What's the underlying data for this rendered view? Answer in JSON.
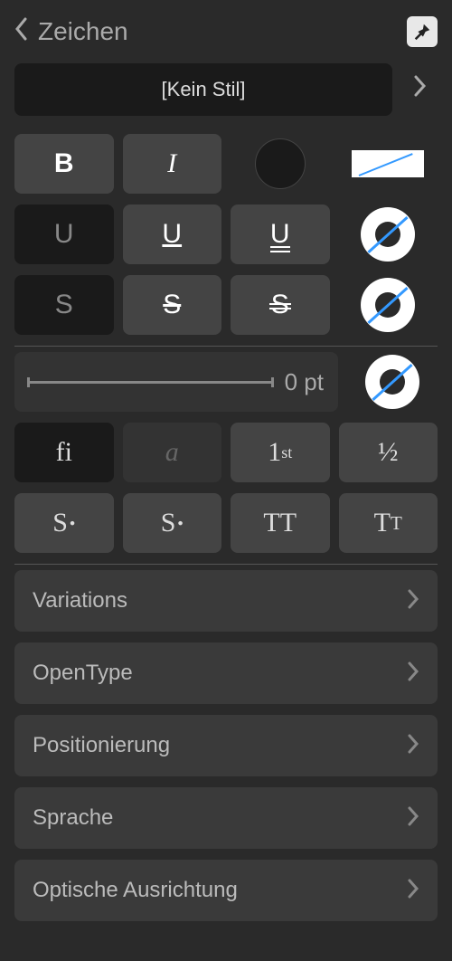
{
  "header": {
    "title": "Zeichen"
  },
  "style": {
    "current": "[Kein Stil]"
  },
  "format": {
    "bold": "B",
    "italic": "I",
    "underline": "U",
    "underline_single": "U",
    "underline_double": "U",
    "strike": "S",
    "strike_single": "S",
    "strike_double": "S"
  },
  "outline": {
    "value": "0 pt"
  },
  "features": {
    "ligature": "fi",
    "stylistic": "a",
    "ordinal_base": "1",
    "ordinal_sup": "st",
    "fraction": "½",
    "super_base": "S",
    "subscript_base": "S",
    "allcaps": "TT",
    "smallcaps_big": "T",
    "smallcaps_small": "T"
  },
  "nav": {
    "variations": "Variations",
    "opentype": "OpenType",
    "positioning": "Positionierung",
    "language": "Sprache",
    "optical": "Optische Ausrichtung"
  }
}
